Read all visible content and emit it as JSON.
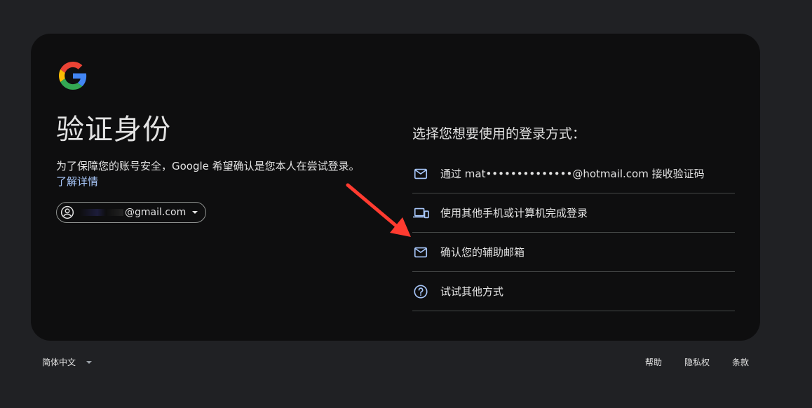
{
  "title": "验证身份",
  "description": "为了保障您的账号安全，Google 希望确认是您本人在尝试登录。",
  "learn_more": "了解详情",
  "account": {
    "email_suffix": "@gmail.com"
  },
  "options_heading": "选择您想要使用的登录方式：",
  "options": [
    {
      "label": "通过 mat••••••••••••••@hotmail.com 接收验证码",
      "icon": "mail-icon"
    },
    {
      "label": "使用其他手机或计算机完成登录",
      "icon": "devices-icon"
    },
    {
      "label": "确认您的辅助邮箱",
      "icon": "mail-icon"
    },
    {
      "label": "试试其他方式",
      "icon": "help-circle-icon"
    }
  ],
  "footer": {
    "language": "简体中文",
    "help": "帮助",
    "privacy": "隐私权",
    "terms": "条款"
  },
  "colors": {
    "background": "#202124",
    "card": "#0e0e0f",
    "link": "#a8c7fa",
    "annotation_arrow": "#ff3b30"
  }
}
